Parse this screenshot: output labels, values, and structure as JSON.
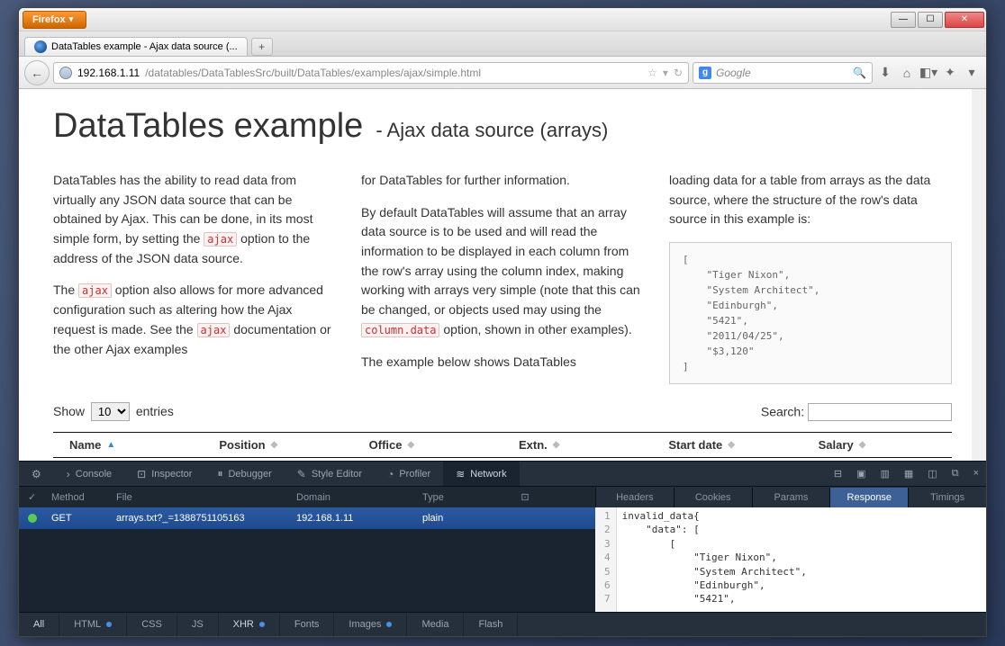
{
  "browser": {
    "firefox_label": "Firefox",
    "tab_title": "DataTables example - Ajax data source (...",
    "url_host": "192.168.1.11",
    "url_path": "/datatables/DataTablesSrc/built/DataTables/examples/ajax/simple.html",
    "search_engine": "Google"
  },
  "page": {
    "h1": "DataTables example",
    "subtitle": "- Ajax data source (arrays)",
    "col1_p1_a": "DataTables has the ability to read data from virtually any JSON data source that can be obtained by Ajax. This can be done, in its most simple form, by setting the ",
    "col1_p1_code": "ajax",
    "col1_p1_b": " option to the address of the JSON data source.",
    "col1_p2_a": "The ",
    "col1_p2_code": "ajax",
    "col1_p2_b": " option also allows for more advanced configuration such as altering how the Ajax request is made. See the ",
    "col1_p2_code2": "ajax",
    "col1_p2_c": " documentation or the other Ajax examples",
    "col2_p1": "for DataTables for further information.",
    "col2_p2_a": "By default DataTables will assume that an array data source is to be used and will read the information to be displayed in each column from the row's array using the column index, making working with arrays very simple (note that this can be changed, or objects used may using the ",
    "col2_p2_code": "column.data",
    "col2_p2_b": " option, shown in other examples).",
    "col2_p3": "The example below shows DataTables",
    "col3_p1": "loading data for a table from arrays as the data source, where the structure of the row's data source in this example is:",
    "codebox": "[\n    \"Tiger Nixon\",\n    \"System Architect\",\n    \"Edinburgh\",\n    \"5421\",\n    \"2011/04/25\",\n    \"$3,120\"\n]",
    "show_label": "Show",
    "show_value": "10",
    "entries_label": "entries",
    "search_label": "Search:",
    "headers": [
      "Name",
      "Position",
      "Office",
      "Extn.",
      "Start date",
      "Salary"
    ]
  },
  "devtools": {
    "tools": [
      "Console",
      "Inspector",
      "Debugger",
      "Style Editor",
      "Profiler",
      "Network"
    ],
    "net_headers": [
      "✓",
      "Method",
      "File",
      "Domain",
      "Type"
    ],
    "row": {
      "method": "GET",
      "file": "arrays.txt?_=1388751105163",
      "domain": "192.168.1.11",
      "type": "plain"
    },
    "detail_tabs": [
      "Headers",
      "Cookies",
      "Params",
      "Response",
      "Timings"
    ],
    "response_text": "invalid_data{\n    \"data\": [\n        [\n            \"Tiger Nixon\",\n            \"System Architect\",\n            \"Edinburgh\",\n            \"5421\",",
    "filters": [
      "All",
      "HTML",
      "CSS",
      "JS",
      "XHR",
      "Fonts",
      "Images",
      "Media",
      "Flash"
    ]
  }
}
